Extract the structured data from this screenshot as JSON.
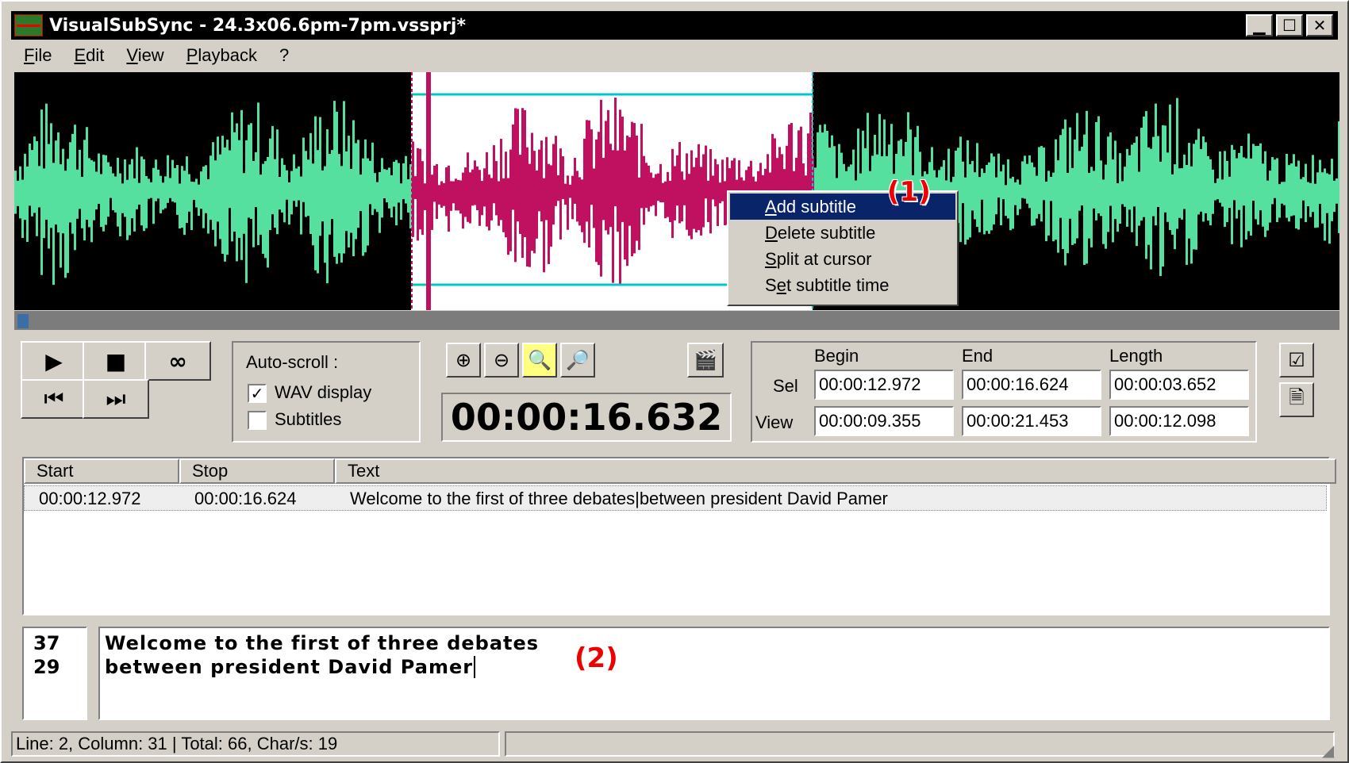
{
  "window": {
    "title": "VisualSubSync - 24.3x06.6pm-7pm.vssprj*",
    "min_glyph": "▁",
    "max_glyph": "☐",
    "close_glyph": "✕"
  },
  "menu": [
    {
      "accel": "F",
      "rest": "ile"
    },
    {
      "accel": "E",
      "rest": "dit"
    },
    {
      "accel": "V",
      "rest": "iew"
    },
    {
      "accel": "P",
      "rest": "layback"
    },
    {
      "accel": "",
      "rest": "?"
    }
  ],
  "context_menu": {
    "items": [
      {
        "accel": "A",
        "rest": "dd subtitle",
        "selected": true
      },
      {
        "accel": "D",
        "rest": "elete subtitle",
        "selected": false
      },
      {
        "accel": "S",
        "rest": "plit at cursor",
        "selected": false
      },
      {
        "pre": "S",
        "accel": "e",
        "rest": "t subtitle time",
        "selected": false
      }
    ]
  },
  "annotations": {
    "one": "(1)",
    "two": "(2)"
  },
  "transport": {
    "play": "▶",
    "stop": "■",
    "loop": "∞",
    "prev": "⏮",
    "next": "⏭"
  },
  "autoscroll": {
    "label": "Auto-scroll :",
    "wav_display": {
      "label": "WAV display",
      "checked": true
    },
    "subtitles": {
      "label": "Subtitles",
      "checked": false
    }
  },
  "zoom_icons": [
    "zoom-in-icon",
    "zoom-out-icon",
    "zoom-selection-icon",
    "zoom-all-icon"
  ],
  "current_time": "00:00:16.632",
  "times": {
    "headers": {
      "begin": "Begin",
      "end": "End",
      "length": "Length"
    },
    "sel_label": "Sel",
    "view_label": "View",
    "sel": {
      "begin": "00:00:12.972",
      "end": "00:00:16.624",
      "length": "00:00:03.652"
    },
    "view": {
      "begin": "00:00:09.355",
      "end": "00:00:21.453",
      "length": "00:00:12.098"
    }
  },
  "list": {
    "columns": [
      "Start",
      "Stop",
      "Text"
    ],
    "rows": [
      {
        "start": "00:00:12.972",
        "stop": "00:00:16.624",
        "text": "Welcome to the first of three debates|between president David Pamer"
      }
    ]
  },
  "editor": {
    "counts": [
      "37",
      "29"
    ],
    "lines": [
      "Welcome to the first of three debates",
      "between president David Pamer"
    ]
  },
  "status": "Line: 2, Column: 31 | Total: 66, Char/s: 19",
  "colors": {
    "wave": "#55e0a0",
    "wave_selected": "#c01060",
    "selection_bg": "#ffffff",
    "cursor_line": "#00c8c8",
    "highlight": "#0a246a"
  }
}
